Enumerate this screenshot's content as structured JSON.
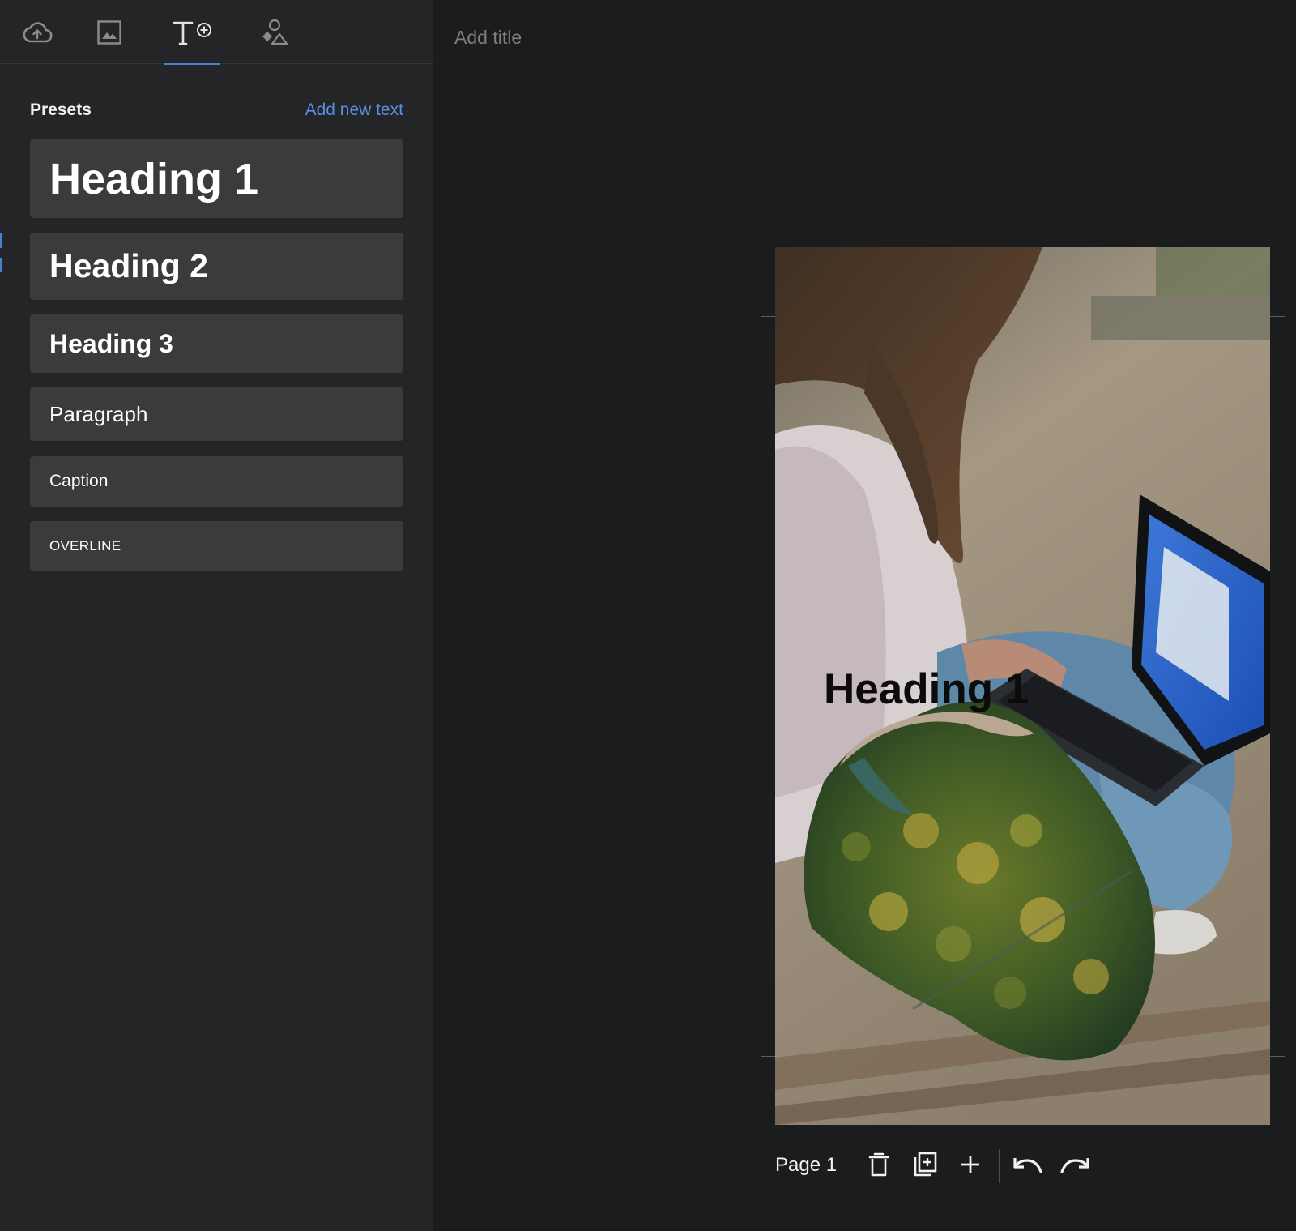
{
  "sidebar": {
    "tabs": [
      {
        "icon": "cloud-upload-icon",
        "selected": false
      },
      {
        "icon": "image-icon",
        "selected": false
      },
      {
        "icon": "text-add-icon",
        "selected": true
      },
      {
        "icon": "shapes-icon",
        "selected": false
      }
    ],
    "presets_label": "Presets",
    "add_new_text": "Add new text",
    "presets": [
      {
        "label": "Heading 1"
      },
      {
        "label": "Heading 2"
      },
      {
        "label": "Heading 3"
      },
      {
        "label": "Paragraph"
      },
      {
        "label": "Caption"
      },
      {
        "label": "OVERLINE"
      }
    ]
  },
  "workspace": {
    "title_placeholder": "Add title",
    "canvas": {
      "heading_text": "Heading 1",
      "background_image": "woman-with-laptop-photo",
      "blob_image": "forest-aerial-photo"
    },
    "toolbar": {
      "page_label": "Page 1",
      "actions": [
        "delete-page-icon",
        "duplicate-page-icon",
        "add-page-icon",
        "undo-icon",
        "redo-icon"
      ]
    }
  },
  "colors": {
    "accent": "#5a8de0",
    "sidebar_bg": "#242526",
    "workspace_bg": "#1b1c1d",
    "preset_bg": "#3a3b3c"
  }
}
